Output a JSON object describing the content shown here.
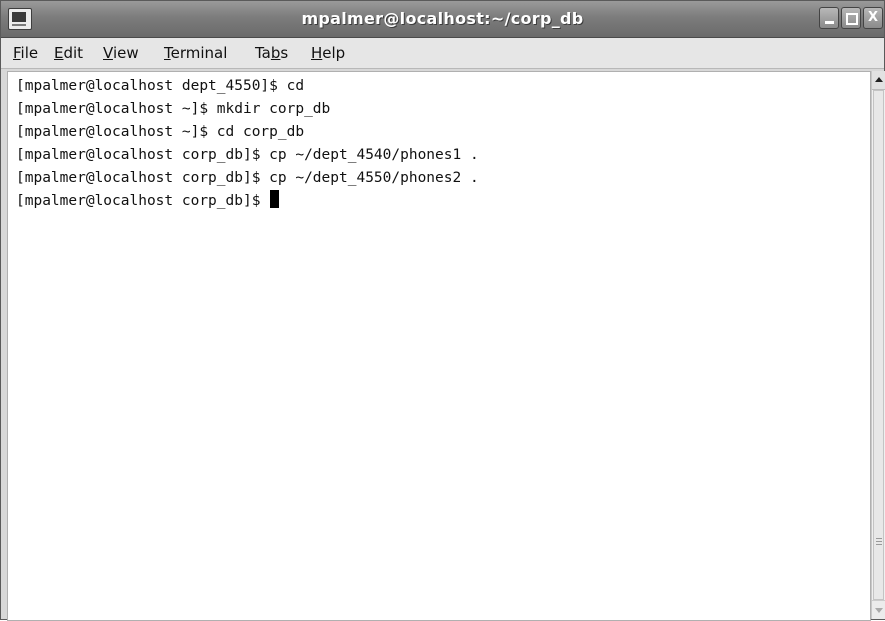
{
  "window": {
    "title": "mpalmer@localhost:~/corp_db",
    "close_glyph": "X"
  },
  "menubar": {
    "items": [
      {
        "label": "File",
        "mnemonic_index": 0
      },
      {
        "label": "Edit",
        "mnemonic_index": 0
      },
      {
        "label": "View",
        "mnemonic_index": 0
      },
      {
        "label": "Terminal",
        "mnemonic_index": 0
      },
      {
        "label": "Tabs",
        "mnemonic_index": 2
      },
      {
        "label": "Help",
        "mnemonic_index": 0
      }
    ]
  },
  "terminal": {
    "lines": [
      "[mpalmer@localhost dept_4550]$ cd",
      "[mpalmer@localhost ~]$ mkdir corp_db",
      "[mpalmer@localhost ~]$ cd corp_db",
      "[mpalmer@localhost corp_db]$ cp ~/dept_4540/phones1 .",
      "[mpalmer@localhost corp_db]$ cp ~/dept_4550/phones2 .",
      "[mpalmer@localhost corp_db]$ "
    ]
  },
  "icons": {
    "app": "terminal-icon",
    "minimize": "minimize-icon",
    "maximize": "maximize-icon",
    "close": "close-icon",
    "scroll_up": "arrow-up-icon",
    "scroll_down": "arrow-down-icon"
  }
}
